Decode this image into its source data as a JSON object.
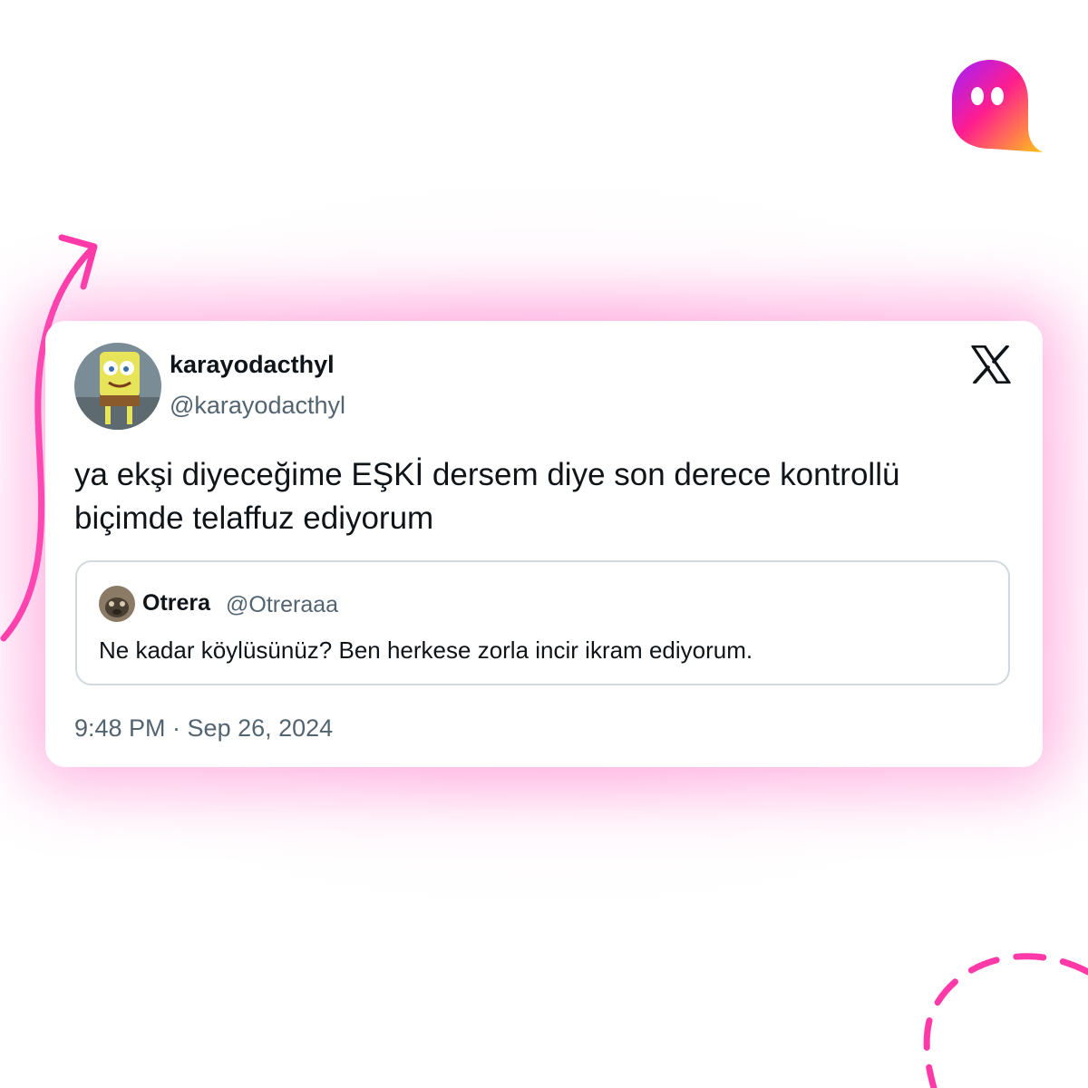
{
  "colors": {
    "accent_pink": "#ff3aa8",
    "glow_pink": "#ff7ccd",
    "text_primary": "#0f1419",
    "text_secondary": "#536471",
    "quote_border": "#cfd9de"
  },
  "brand": {
    "icon": "ghost-logo-icon"
  },
  "tweet": {
    "author": {
      "display_name": "karayodacthyl",
      "handle": "@karayodacthyl",
      "avatar_icon": "spongebob-avatar"
    },
    "platform_icon": "x-logo-icon",
    "text": "ya ekşi diyeceğime EŞKİ dersem diye son derece kontrollü biçimde telaffuz ediyorum",
    "quoted": {
      "display_name": "Otrera",
      "handle": "@Otreraaa",
      "avatar_icon": "animal-avatar",
      "text": "Ne kadar köylüsünüz? Ben herkese zorla incir ikram ediyorum."
    },
    "timestamp": "9:48 PM · Sep 26, 2024"
  }
}
